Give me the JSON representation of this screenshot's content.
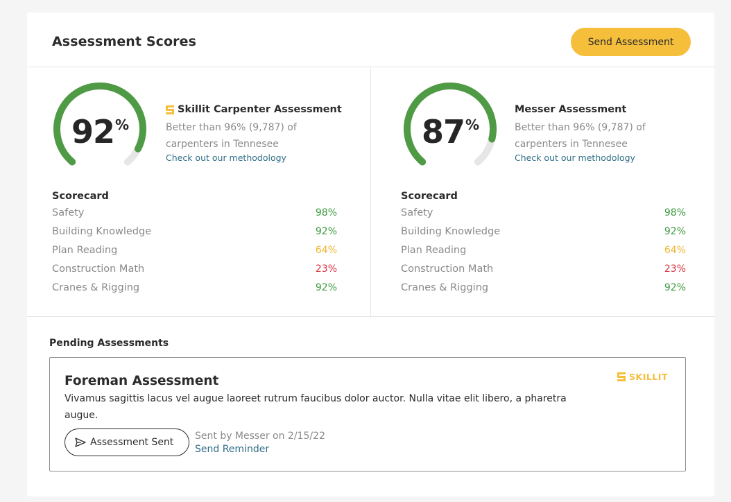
{
  "header": {
    "title": "Assessment Scores",
    "send_button_label": "Send Assessment"
  },
  "assessments": [
    {
      "score_value": "92",
      "score_unit": "%",
      "score_fraction": 0.92,
      "has_logo": true,
      "title": "Skillit Carpenter Assessment",
      "description": "Better than 96% (9,787) of carpenters in Tennesee",
      "link_label": "Check out our methodology",
      "scorecard_heading": "Scorecard",
      "scores": [
        {
          "label": "Safety",
          "value": "98%",
          "color": "#3c9a3e"
        },
        {
          "label": "Building Knowledge",
          "value": "92%",
          "color": "#3c9a3e"
        },
        {
          "label": "Plan Reading",
          "value": "64%",
          "color": "#efb52f"
        },
        {
          "label": "Construction Math",
          "value": "23%",
          "color": "#d9313f"
        },
        {
          "label": "Cranes & Rigging",
          "value": "92%",
          "color": "#3c9a3e"
        }
      ]
    },
    {
      "score_value": "87",
      "score_unit": "%",
      "score_fraction": 0.87,
      "has_logo": false,
      "title": "Messer Assessment",
      "description": "Better than 96% (9,787) of carpenters in Tennesee",
      "link_label": "Check out our methodology",
      "scorecard_heading": "Scorecard",
      "scores": [
        {
          "label": "Safety",
          "value": "98%",
          "color": "#3c9a3e"
        },
        {
          "label": "Building Knowledge",
          "value": "92%",
          "color": "#3c9a3e"
        },
        {
          "label": "Plan Reading",
          "value": "64%",
          "color": "#efb52f"
        },
        {
          "label": "Construction Math",
          "value": "23%",
          "color": "#d9313f"
        },
        {
          "label": "Cranes & Rigging",
          "value": "92%",
          "color": "#3c9a3e"
        }
      ]
    }
  ],
  "pending": {
    "heading": "Pending Assessments",
    "title": "Foreman Assessment",
    "description": "Vivamus sagittis lacus vel augue laoreet rutrum faucibus dolor auctor. Nulla vitae elit libero, a pharetra augue.",
    "brand": "SKILLIT",
    "sent_label": "Assessment Sent",
    "sent_meta": "Sent by Messer on 2/15/22",
    "reminder_label": "Send Reminder"
  },
  "colors": {
    "accent": "#f5bf3c",
    "gauge_fill": "#4f9a45",
    "gauge_track": "#e6e6e6",
    "link": "#2f6f86",
    "good": "#3c9a3e",
    "warn": "#efb52f",
    "bad": "#d9313f"
  },
  "icons": {
    "skillit_logo": "skillit-logo-icon",
    "send": "paper-plane-icon"
  }
}
